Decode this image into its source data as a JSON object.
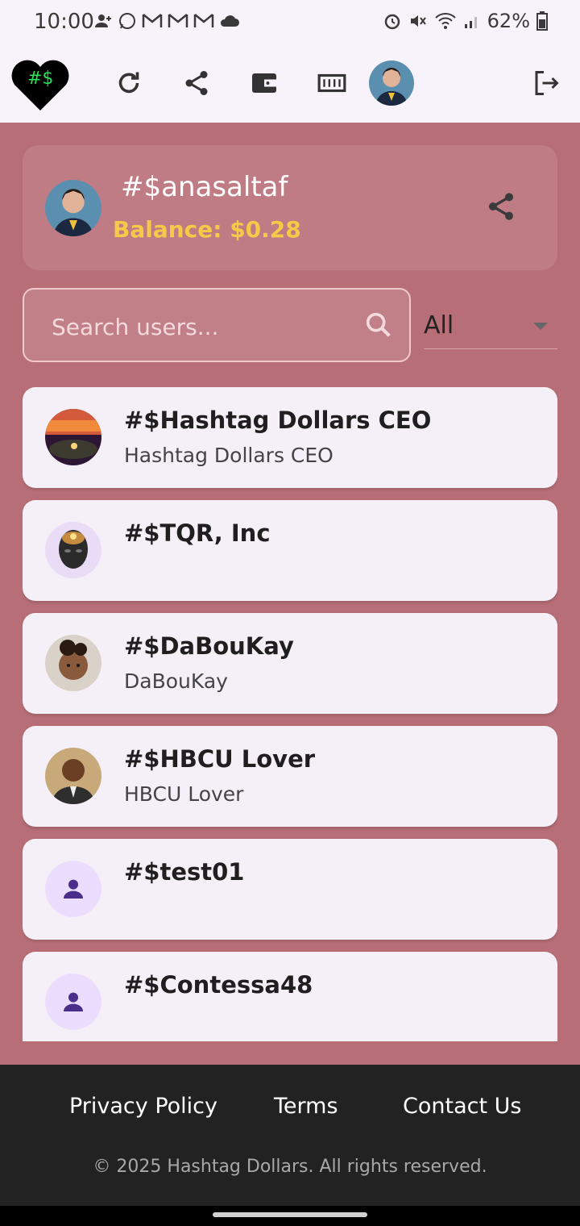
{
  "status_bar": {
    "time": "10:00",
    "battery": "62%",
    "icons": [
      "person-add-icon",
      "whatsapp-icon",
      "gmail-icon",
      "gmail-icon",
      "gmail-icon",
      "cloud-icon",
      "alarm-icon",
      "mute-icon",
      "wifi-icon",
      "signal-icon",
      "battery-icon"
    ]
  },
  "app_bar": {
    "logo_text": "#$",
    "actions": [
      "refresh-icon",
      "share-icon",
      "wallet-icon",
      "money-icon",
      "avatar",
      "logout-icon"
    ]
  },
  "profile": {
    "handle": "#$anasaltaf",
    "balance": "Balance: $0.28"
  },
  "search": {
    "placeholder": "Search users..."
  },
  "filter": {
    "selected": "All"
  },
  "users": [
    {
      "title": "#$Hashtag Dollars CEO",
      "subtitle": "Hashtag Dollars CEO"
    },
    {
      "title": "#$TQR, Inc",
      "subtitle": ""
    },
    {
      "title": "#$DaBouKay",
      "subtitle": "DaBouKay"
    },
    {
      "title": "#$HBCU Lover",
      "subtitle": "HBCU Lover"
    },
    {
      "title": "#$test01",
      "subtitle": ""
    },
    {
      "title": "#$Contessa48",
      "subtitle": ""
    }
  ],
  "footer": {
    "privacy": "Privacy Policy",
    "terms": "Terms",
    "contact": "Contact Us",
    "copyright": "© 2025 Hashtag Dollars. All rights reserved."
  },
  "colors": {
    "background": "#b76e77",
    "card": "#f5f0f7",
    "balance": "#f7c948",
    "footer": "#222222"
  }
}
